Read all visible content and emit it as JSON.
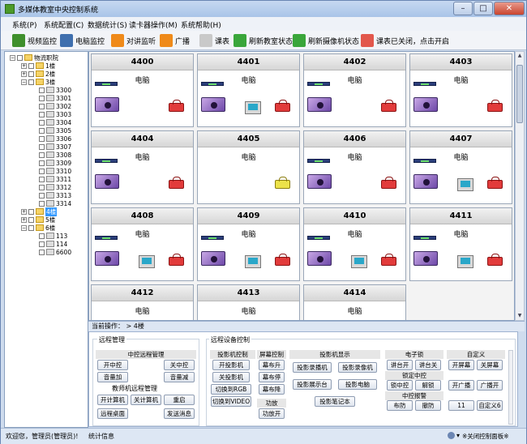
{
  "window": {
    "title": "多媒体教室中央控制系统",
    "minimize_glyph": "–",
    "maximize_glyph": "□",
    "close_glyph": "✕"
  },
  "menu": [
    "系统(P)",
    "系统配置(C)",
    "数据统计(S)",
    "读卡器操作(M)",
    "系统帮助(H)"
  ],
  "toolbar": [
    {
      "label": "视频监控",
      "icon": "camera-icon",
      "color": "#3f8f2c"
    },
    {
      "label": "电脑监控",
      "icon": "monitor-icon",
      "color": "#3f6fae"
    },
    {
      "label": "对讲监听",
      "icon": "intercom-icon",
      "color": "#ef8a1a"
    },
    {
      "label": "广播",
      "icon": "broadcast-icon",
      "color": "#ef8a1a"
    },
    {
      "label": "课表",
      "icon": "schedule-icon",
      "color": "#c9c9c9"
    },
    {
      "label": "刷新教室状态",
      "icon": "refresh-icon",
      "color": "#3aa63a"
    },
    {
      "label": "刷新摄像机状态",
      "icon": "refresh-icon",
      "color": "#3aa63a"
    },
    {
      "label": "课表已关闭，点击开启",
      "icon": "schedule-off-icon",
      "color": "#e2574c"
    }
  ],
  "tree": {
    "root": "物流职院",
    "floors": [
      "1楼",
      "2楼",
      "3楼",
      "4楼",
      "5楼",
      "6楼"
    ],
    "floor3_rooms": [
      "3300",
      "3301",
      "3302",
      "3303",
      "3304",
      "3305",
      "3306",
      "3307",
      "3308",
      "3309",
      "3310",
      "3311",
      "3312",
      "3313",
      "3314"
    ],
    "floor6_rooms": [
      "113",
      "114",
      "6600"
    ],
    "expanded_glyph": "−",
    "collapsed_glyph": "+"
  },
  "classrooms": [
    {
      "room": "4400",
      "device": "电脑",
      "projector": true,
      "visualizer": true,
      "pc": false,
      "lock": "red"
    },
    {
      "room": "4401",
      "device": "电脑",
      "projector": true,
      "visualizer": true,
      "pc": true,
      "lock": "red"
    },
    {
      "room": "4402",
      "device": "电脑",
      "projector": true,
      "visualizer": true,
      "pc": false,
      "lock": "red"
    },
    {
      "room": "4403",
      "device": "电脑",
      "projector": true,
      "visualizer": true,
      "pc": false,
      "lock": "red"
    },
    {
      "room": "4404",
      "device": "电脑",
      "projector": true,
      "visualizer": true,
      "pc": false,
      "lock": "red"
    },
    {
      "room": "4405",
      "device": "电脑",
      "projector": false,
      "visualizer": false,
      "pc": false,
      "lock": "yellow"
    },
    {
      "room": "4406",
      "device": "电脑",
      "projector": true,
      "visualizer": true,
      "pc": false,
      "lock": "red"
    },
    {
      "room": "4407",
      "device": "电脑",
      "projector": true,
      "visualizer": true,
      "pc": true,
      "lock": "red"
    },
    {
      "room": "4408",
      "device": "电脑",
      "projector": true,
      "visualizer": true,
      "pc": true,
      "lock": "red"
    },
    {
      "room": "4409",
      "device": "电脑",
      "projector": true,
      "visualizer": true,
      "pc": true,
      "lock": "red"
    },
    {
      "room": "4410",
      "device": "电脑",
      "projector": true,
      "visualizer": true,
      "pc": true,
      "lock": "red"
    },
    {
      "room": "4411",
      "device": "电脑",
      "projector": true,
      "visualizer": true,
      "pc": true,
      "lock": "red"
    },
    {
      "room": "4412",
      "device": "电脑",
      "projector": false,
      "visualizer": false,
      "pc": false,
      "lock": "none"
    },
    {
      "room": "4413",
      "device": "电脑",
      "projector": false,
      "visualizer": false,
      "pc": false,
      "lock": "none"
    },
    {
      "room": "4414",
      "device": "电脑",
      "projector": false,
      "visualizer": false,
      "pc": false,
      "lock": "none"
    }
  ],
  "current_op": {
    "label": "当前操作：",
    "value": "> 4楼"
  },
  "remote": {
    "title": "远程管理",
    "center_title": "中控远程管理",
    "on": "开中控",
    "off": "关中控",
    "vol_up": "音量加",
    "vol_down": "音量减",
    "teacher_title": "教师机远程管理",
    "pc_on": "开计算机",
    "pc_off": "关计算机",
    "restart": "重启",
    "desktop": "远程桌面",
    "message": "发送消息"
  },
  "device": {
    "title": "远程设备控制",
    "proj_ctrl": "投影机控制",
    "proj_on": "开投影机",
    "proj_off": "关投影机",
    "to_rgb": "切换到RGB",
    "to_video": "切换到VIDEO",
    "screen_ctrl": "屏幕控制",
    "screen_up": "幕布升",
    "screen_stop": "幕布停",
    "screen_down": "幕布降",
    "amp": "功放",
    "amp_on": "功放开",
    "display": "投影机显示",
    "d_proj": "投影录播机",
    "d_rec": "投影录像机",
    "d_stand": "投影展示台",
    "d_pc": "投影电脑",
    "d_nb": "投影笔记本",
    "elock": "电子锁",
    "lock_on": "讲台开",
    "lock_off": "讲台关",
    "lockctrl": "锁定中控",
    "lock_center": "锁中控",
    "unlock": "解锁",
    "alarm": "中控报警",
    "arm": "布防",
    "disarm": "撤防",
    "custom": "自定义",
    "scr_on": "开屏幕",
    "scr_off": "关屏幕",
    "bc_on": "开广播",
    "bc_off": "广播开",
    "c11": "11",
    "c6": "自定义6"
  },
  "status": {
    "welcome": "欢迎您，管理员(管理员)!",
    "info": "统计信息",
    "toggle": "※关闭控制面板※"
  }
}
